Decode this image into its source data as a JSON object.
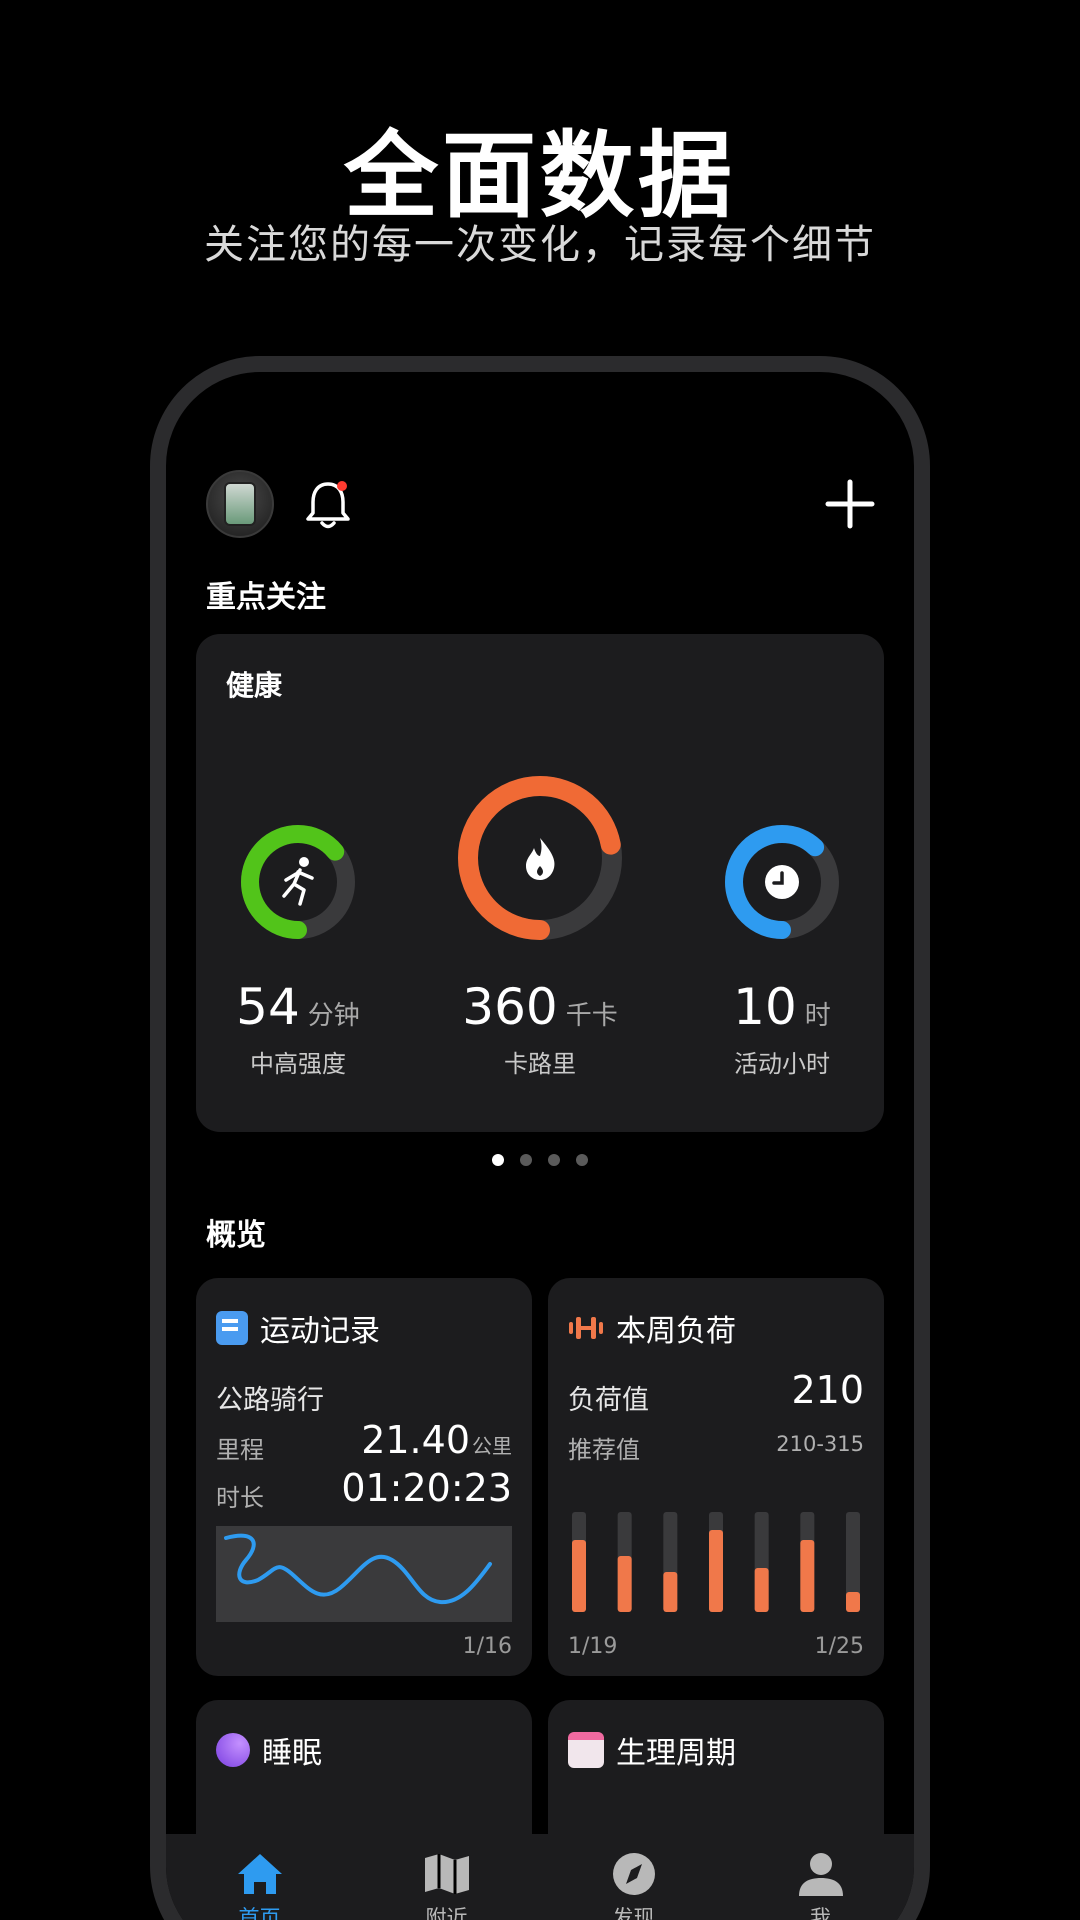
{
  "promo": {
    "headline": "全面数据",
    "subline": "关注您的每一次变化，记录每个细节"
  },
  "header": {
    "icons": [
      "watch-avatar-icon",
      "bell-icon",
      "plus-icon"
    ],
    "notification_dot": true
  },
  "focus": {
    "section_title": "重点关注",
    "card_title": "健康",
    "metrics": [
      {
        "value": "54",
        "unit": "分钟",
        "label": "中高强度",
        "progress": 0.64,
        "color": "#52c41a",
        "icon": "running-icon"
      },
      {
        "value": "360",
        "unit": "千卡",
        "label": "卡路里",
        "progress": 0.72,
        "color": "#f06a35",
        "icon": "flame-icon"
      },
      {
        "value": "10",
        "unit": "时",
        "label": "活动小时",
        "progress": 0.62,
        "color": "#2e9bf0",
        "icon": "clock-icon"
      }
    ],
    "pager": {
      "count": 4,
      "active": 0
    }
  },
  "overview": {
    "section_title": "概览",
    "workout": {
      "title": "运动记录",
      "activity": "公路骑行",
      "distance_label": "里程",
      "distance_value": "21.40",
      "distance_unit": "公里",
      "duration_label": "时长",
      "duration_value": "01:20:23",
      "date": "1/16"
    },
    "load": {
      "title": "本周负荷",
      "load_label": "负荷值",
      "load_value": "210",
      "recommended_label": "推荐值",
      "recommended_value": "210-315",
      "start_date": "1/19",
      "end_date": "1/25",
      "bars": [
        0.72,
        0.56,
        0.4,
        0.82,
        0.44,
        0.72,
        0.2
      ]
    },
    "sleep": {
      "title": "睡眠"
    },
    "cycle": {
      "title": "生理周期"
    }
  },
  "tabbar": {
    "items": [
      {
        "label": "首页",
        "icon": "home-icon",
        "active": true
      },
      {
        "label": "附近",
        "icon": "map-icon",
        "active": false
      },
      {
        "label": "发现",
        "icon": "compass-icon",
        "active": false
      },
      {
        "label": "我",
        "icon": "person-icon",
        "active": false
      }
    ]
  },
  "colors": {
    "card_bg": "#1c1c1e",
    "accent_blue": "#2e9bf0",
    "load_orange": "#f0784a"
  }
}
